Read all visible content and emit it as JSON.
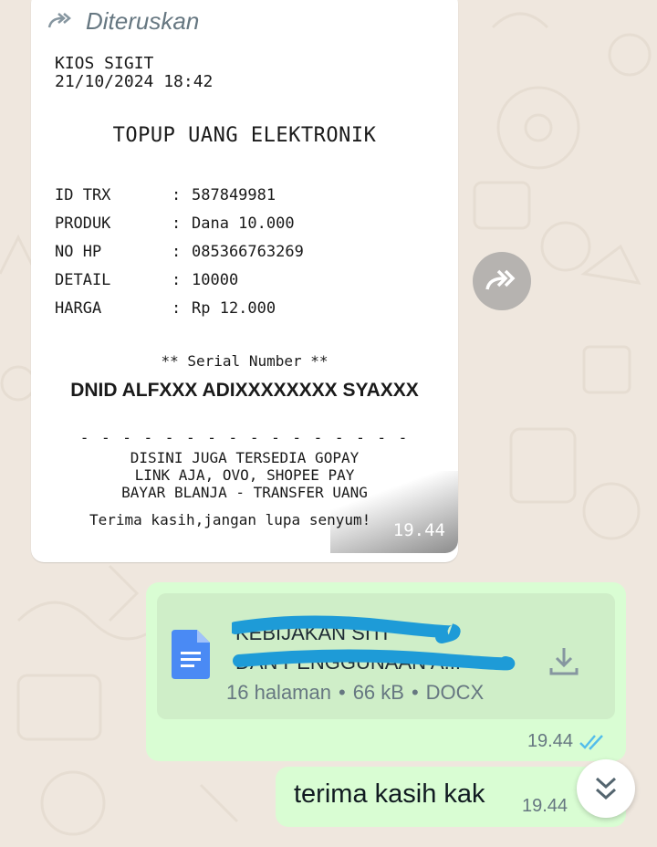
{
  "chat": {
    "forwarded_message": {
      "forwarded_label": "Diteruskan",
      "time": "19.44",
      "receipt": {
        "shop_name": "KIOS SIGIT",
        "datetime": "21/10/2024 18:42",
        "title": "TOPUP UANG ELEKTRONIK",
        "rows": [
          {
            "key": "ID TRX",
            "value": "587849981"
          },
          {
            "key": "PRODUK",
            "value": "Dana 10.000"
          },
          {
            "key": "NO HP",
            "value": "085366763269"
          },
          {
            "key": "DETAIL",
            "value": "10000"
          },
          {
            "key": "HARGA",
            "value": "Rp 12.000"
          }
        ],
        "separator": ":",
        "serial_label": "** Serial Number **",
        "serial_value": "DNID ALFXXX ADIXXXXXXXX SYAXXX",
        "dash_line": "- - - - - - - - - - - - - - - -",
        "promo_lines": [
          "DISINI JUGA TERSEDIA GOPAY",
          "LINK AJA, OVO, SHOPEE PAY",
          "BAYAR BLANJA - TRANSFER UANG"
        ],
        "thanks": "Terima kasih,jangan lupa senyum!"
      }
    },
    "document_message": {
      "file_name_line1": "KEBIJAKAN SITI",
      "file_name_line2": "DAN PENGGUNAAN A...",
      "pages": "16 halaman",
      "size": "66 kB",
      "type": "DOCX",
      "meta_separator": "•",
      "time": "19.44",
      "status": "read"
    },
    "text_message": {
      "text": "terima kasih kak",
      "time": "19.44"
    }
  },
  "colors": {
    "wallpaper": "#efe7de",
    "outgoing_bubble": "#d9fdd3",
    "read_ticks": "#53bdeb",
    "doc_icon": "#4a8af4"
  }
}
